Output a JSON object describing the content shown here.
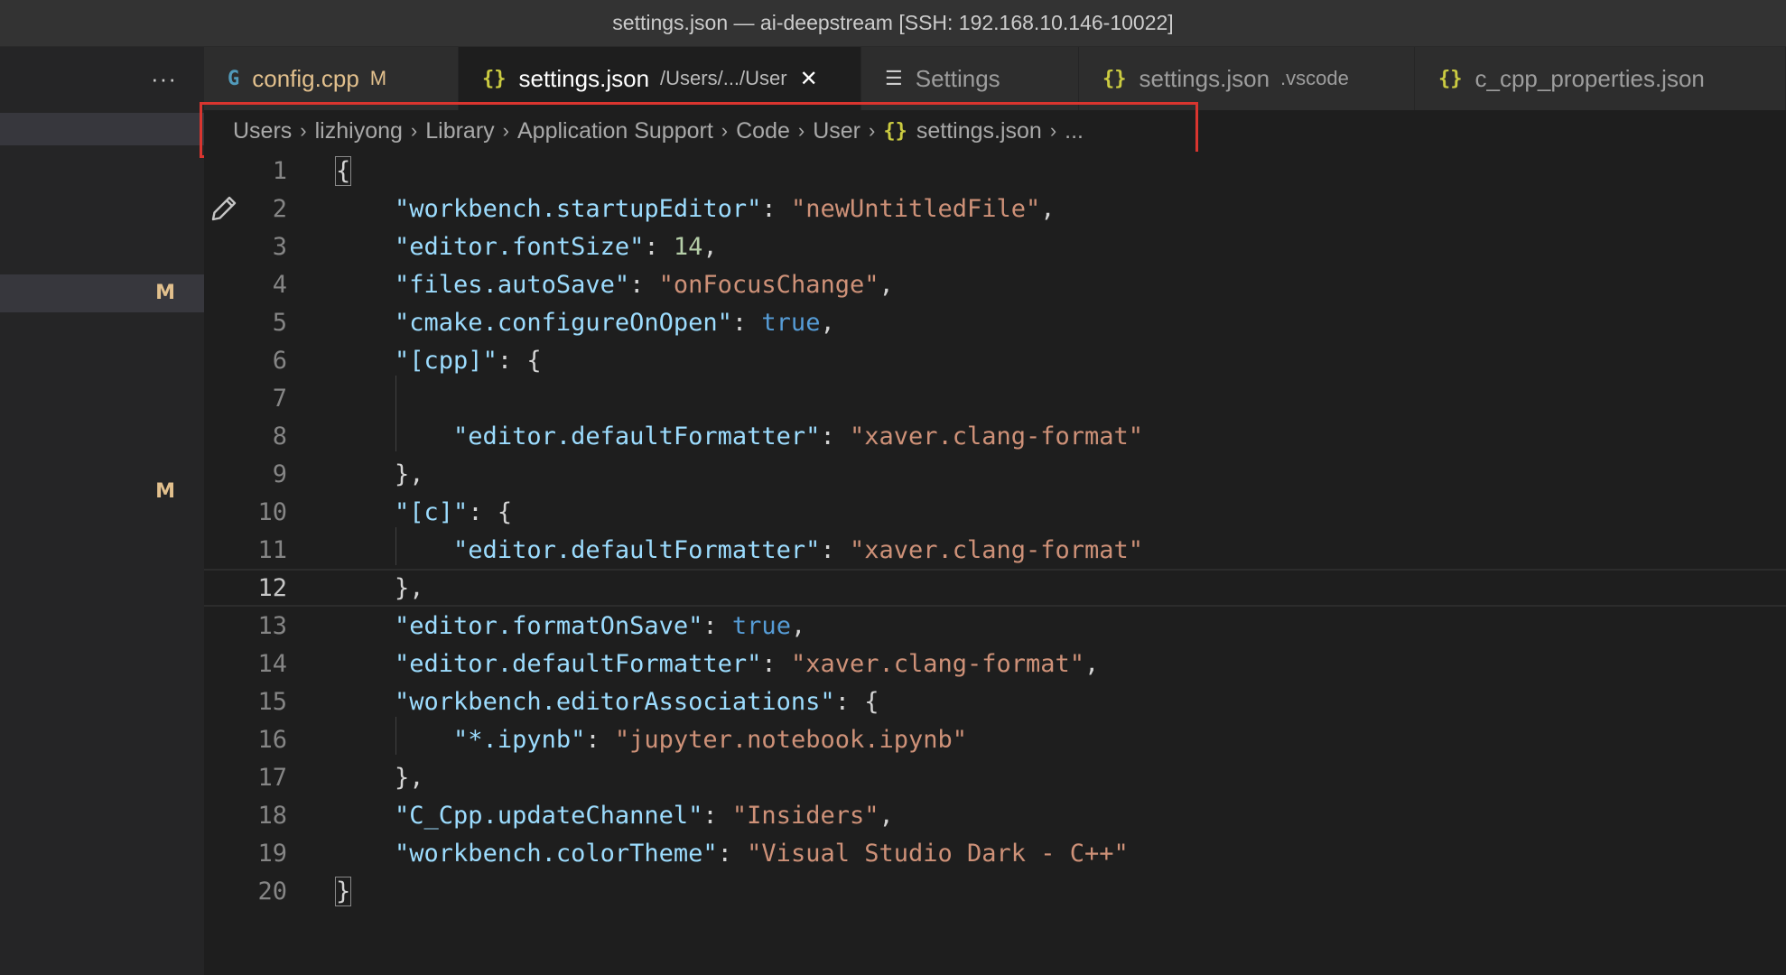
{
  "window": {
    "title": "settings.json — ai-deepstream [SSH: 192.168.10.146-10022]"
  },
  "sidebar": {
    "more_label": "···",
    "badges": [
      "M",
      "M"
    ]
  },
  "tabs": [
    {
      "label": "config.cpp",
      "icon": "cpp-file-icon",
      "modified": "M",
      "description": "",
      "active": false
    },
    {
      "label": "settings.json",
      "icon": "json-file-icon",
      "modified": "",
      "description": "/Users/.../User",
      "active": true,
      "close": "✕"
    },
    {
      "label": "Settings",
      "icon": "settings-editor-icon",
      "modified": "",
      "description": "",
      "active": false
    },
    {
      "label": "settings.json",
      "icon": "json-file-icon",
      "modified": "",
      "description": ".vscode",
      "active": false
    },
    {
      "label": "c_cpp_properties.json",
      "icon": "json-file-icon",
      "modified": "",
      "description": "",
      "active": false
    }
  ],
  "breadcrumb": {
    "items": [
      "Users",
      "lizhiyong",
      "Library",
      "Application Support",
      "Code",
      "User",
      "settings.json",
      "..."
    ]
  },
  "editor": {
    "current_line": 12,
    "lines": [
      {
        "num": "1",
        "tokens": [
          [
            "p",
            "{"
          ]
        ]
      },
      {
        "num": "2",
        "tokens": [
          [
            "p",
            "    "
          ],
          [
            "k",
            "\"workbench.startupEditor\""
          ],
          [
            "p",
            ": "
          ],
          [
            "s",
            "\"newUntitledFile\""
          ],
          [
            "p",
            ","
          ]
        ]
      },
      {
        "num": "3",
        "tokens": [
          [
            "p",
            "    "
          ],
          [
            "k",
            "\"editor.fontSize\""
          ],
          [
            "p",
            ": "
          ],
          [
            "n",
            "14"
          ],
          [
            "p",
            ","
          ]
        ]
      },
      {
        "num": "4",
        "tokens": [
          [
            "p",
            "    "
          ],
          [
            "k",
            "\"files.autoSave\""
          ],
          [
            "p",
            ": "
          ],
          [
            "s",
            "\"onFocusChange\""
          ],
          [
            "p",
            ","
          ]
        ]
      },
      {
        "num": "5",
        "tokens": [
          [
            "p",
            "    "
          ],
          [
            "k",
            "\"cmake.configureOnOpen\""
          ],
          [
            "p",
            ": "
          ],
          [
            "b",
            "true"
          ],
          [
            "p",
            ","
          ]
        ]
      },
      {
        "num": "6",
        "tokens": [
          [
            "p",
            "    "
          ],
          [
            "k",
            "\"[cpp]\""
          ],
          [
            "p",
            ": {"
          ]
        ]
      },
      {
        "num": "7",
        "tokens": [
          [
            "p",
            ""
          ]
        ]
      },
      {
        "num": "8",
        "tokens": [
          [
            "p",
            "        "
          ],
          [
            "k",
            "\"editor.defaultFormatter\""
          ],
          [
            "p",
            ": "
          ],
          [
            "s",
            "\"xaver.clang-format\""
          ]
        ]
      },
      {
        "num": "9",
        "tokens": [
          [
            "p",
            "    },"
          ]
        ]
      },
      {
        "num": "10",
        "tokens": [
          [
            "p",
            "    "
          ],
          [
            "k",
            "\"[c]\""
          ],
          [
            "p",
            ": {"
          ]
        ]
      },
      {
        "num": "11",
        "tokens": [
          [
            "p",
            "        "
          ],
          [
            "k",
            "\"editor.defaultFormatter\""
          ],
          [
            "p",
            ": "
          ],
          [
            "s",
            "\"xaver.clang-format\""
          ]
        ]
      },
      {
        "num": "12",
        "tokens": [
          [
            "p",
            "    },"
          ]
        ]
      },
      {
        "num": "13",
        "tokens": [
          [
            "p",
            "    "
          ],
          [
            "k",
            "\"editor.formatOnSave\""
          ],
          [
            "p",
            ": "
          ],
          [
            "b",
            "true"
          ],
          [
            "p",
            ","
          ]
        ]
      },
      {
        "num": "14",
        "tokens": [
          [
            "p",
            "    "
          ],
          [
            "k",
            "\"editor.defaultFormatter\""
          ],
          [
            "p",
            ": "
          ],
          [
            "s",
            "\"xaver.clang-format\""
          ],
          [
            "p",
            ","
          ]
        ]
      },
      {
        "num": "15",
        "tokens": [
          [
            "p",
            "    "
          ],
          [
            "k",
            "\"workbench.editorAssociations\""
          ],
          [
            "p",
            ": {"
          ]
        ]
      },
      {
        "num": "16",
        "tokens": [
          [
            "p",
            "        "
          ],
          [
            "k",
            "\"*.ipynb\""
          ],
          [
            "p",
            ": "
          ],
          [
            "s",
            "\"jupyter.notebook.ipynb\""
          ]
        ]
      },
      {
        "num": "17",
        "tokens": [
          [
            "p",
            "    },"
          ]
        ]
      },
      {
        "num": "18",
        "tokens": [
          [
            "p",
            "    "
          ],
          [
            "k",
            "\"C_Cpp.updateChannel\""
          ],
          [
            "p",
            ": "
          ],
          [
            "s",
            "\"Insiders\""
          ],
          [
            "p",
            ","
          ]
        ]
      },
      {
        "num": "19",
        "tokens": [
          [
            "p",
            "    "
          ],
          [
            "k",
            "\"workbench.colorTheme\""
          ],
          [
            "p",
            ": "
          ],
          [
            "s",
            "\"Visual Studio Dark - C++\""
          ]
        ]
      },
      {
        "num": "20",
        "tokens": [
          [
            "p",
            "}"
          ]
        ]
      }
    ]
  },
  "colors": {
    "key": "#9cdcfe",
    "string": "#ce9178",
    "number": "#b5cea8",
    "boolean": "#569cd6",
    "modified": "#e2c08d",
    "json_icon": "#cbcb41",
    "highlight_border": "#d9352f"
  }
}
